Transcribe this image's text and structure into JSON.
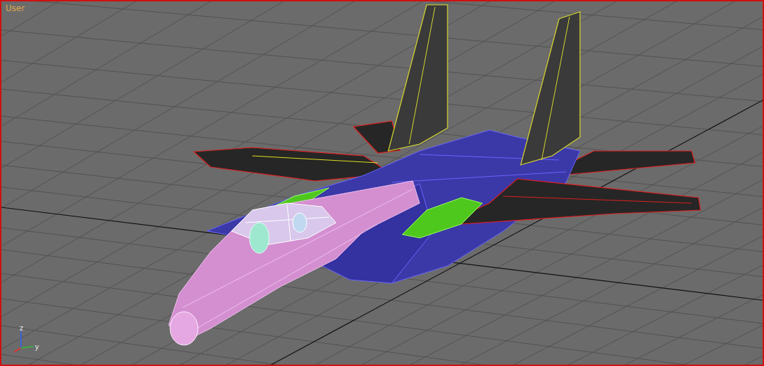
{
  "viewport": {
    "label": "User",
    "active": true
  },
  "axis_tripod": {
    "labels": [
      "z",
      "y"
    ]
  }
}
